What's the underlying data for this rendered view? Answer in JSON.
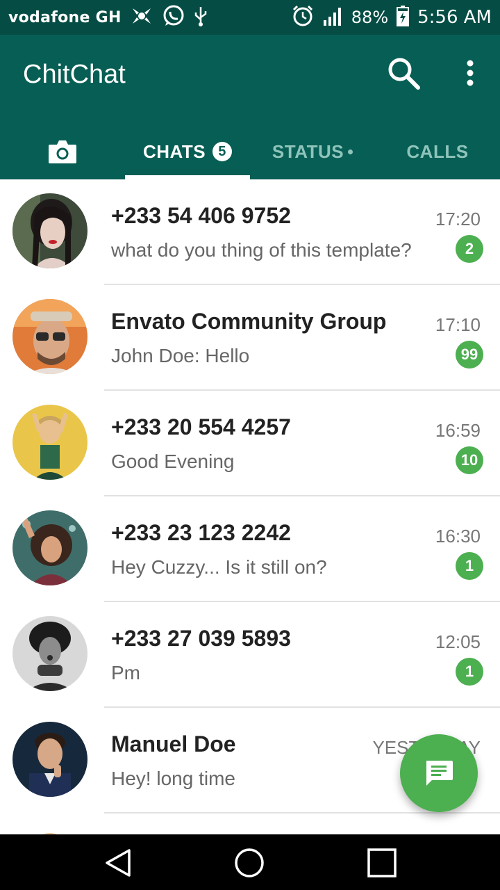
{
  "status_bar": {
    "carrier": "vodafone GH",
    "battery": "88%",
    "time": "5:56 AM",
    "icons": [
      "sync-icon",
      "whatsapp-icon",
      "usb-icon",
      "alarm-icon",
      "signal-icon",
      "battery-charging-icon"
    ]
  },
  "app_bar": {
    "title": "ChitChat",
    "actions": [
      "search-icon",
      "more-vert-icon"
    ]
  },
  "tabs": {
    "camera_icon": "camera-icon",
    "chats_label": "CHATS",
    "chats_badge": "5",
    "status_label": "STATUS",
    "calls_label": "CALLS",
    "selected": "CHATS"
  },
  "chats": [
    {
      "name": "+233 54 406 9752",
      "time": "17:20",
      "message": "what do you thing of this template?",
      "unread": "2"
    },
    {
      "name": "Envato Community Group",
      "time": "17:10",
      "message": "John Doe: Hello",
      "unread": "99"
    },
    {
      "name": "+233 20 554 4257",
      "time": "16:59",
      "message": "Good Evening",
      "unread": "10"
    },
    {
      "name": "+233 23 123 2242",
      "time": "16:30",
      "message": "Hey Cuzzy... Is it still on?",
      "unread": "1"
    },
    {
      "name": "+233 27 039 5893",
      "time": "12:05",
      "message": "Pm",
      "unread": "1"
    },
    {
      "name": "Manuel Doe",
      "time": "YESTERDAY",
      "message": "Hey! long time",
      "unread": ""
    }
  ],
  "fab_icon": "message-icon",
  "colors": {
    "primary": "#075e54",
    "status_bar": "#054d44",
    "accent": "#4caf50"
  }
}
